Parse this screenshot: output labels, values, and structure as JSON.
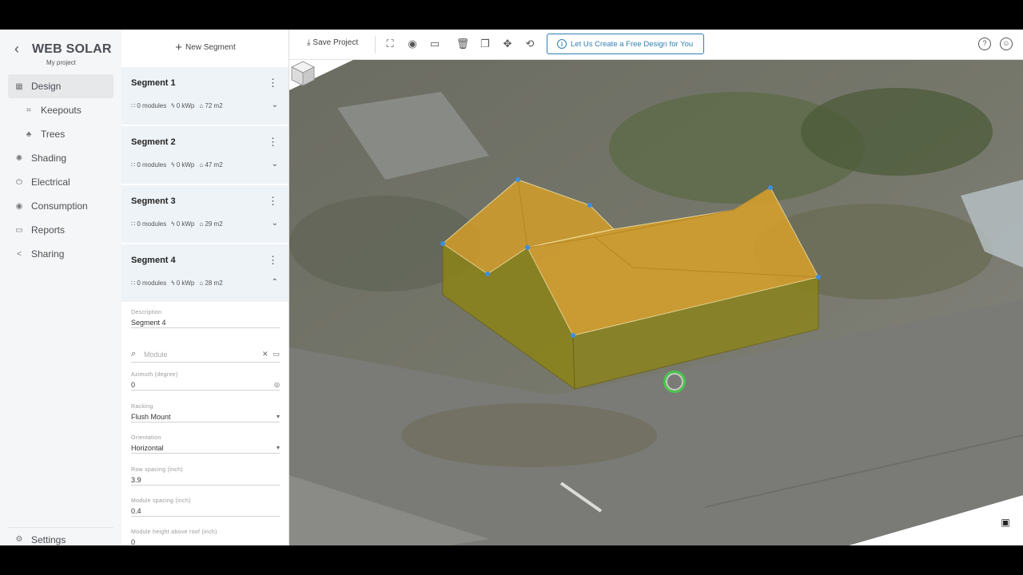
{
  "app": {
    "title": "WEB SOLAR",
    "subtitle": "My project"
  },
  "nav": {
    "items": [
      {
        "label": "Design",
        "icon": "grid-icon",
        "glyph": "▦"
      },
      {
        "label": "Keepouts",
        "icon": "keepout-icon",
        "glyph": "⌗"
      },
      {
        "label": "Trees",
        "icon": "tree-icon",
        "glyph": "♣"
      },
      {
        "label": "Shading",
        "icon": "sun-icon",
        "glyph": "✺"
      },
      {
        "label": "Electrical",
        "icon": "plug-icon",
        "glyph": "⏻"
      },
      {
        "label": "Consumption",
        "icon": "meter-icon",
        "glyph": "◉"
      },
      {
        "label": "Reports",
        "icon": "folder-icon",
        "glyph": "▭"
      },
      {
        "label": "Sharing",
        "icon": "share-icon",
        "glyph": "<"
      }
    ],
    "settings": {
      "label": "Settings",
      "icon": "gear-icon",
      "glyph": "⚙"
    }
  },
  "panel": {
    "new_segment": "New Segment",
    "segments": [
      {
        "name": "Segment 1",
        "modules": "0 modules",
        "kwp": "0 kWp",
        "area": "72 m2",
        "expanded": false
      },
      {
        "name": "Segment 2",
        "modules": "0 modules",
        "kwp": "0 kWp",
        "area": "47 m2",
        "expanded": false
      },
      {
        "name": "Segment 3",
        "modules": "0 modules",
        "kwp": "0 kWp",
        "area": "29 m2",
        "expanded": false
      },
      {
        "name": "Segment 4",
        "modules": "0 modules",
        "kwp": "0 kWp",
        "area": "28 m2",
        "expanded": true
      }
    ],
    "form": {
      "description_label": "Description",
      "description_value": "Segment 4",
      "module_placeholder": "Module",
      "azimuth_label": "Azimuth (degree)",
      "azimuth_value": "0",
      "racking_label": "Racking",
      "racking_value": "Flush Mount",
      "orientation_label": "Orientation",
      "orientation_value": "Horizontal",
      "row_spacing_label": "Row spacing (inch)",
      "row_spacing_value": "3.9",
      "module_spacing_label": "Module spacing (inch)",
      "module_spacing_value": "0.4",
      "module_height_label": "Module height above roof (inch)",
      "module_height_value": "0"
    }
  },
  "toolbar": {
    "save_label": "Save Project",
    "cta_label": "Let Us Create a Free Design for You",
    "icons": [
      "fullscreen-icon",
      "eye-icon",
      "ruler-icon",
      "trash-icon",
      "copy-icon",
      "move-icon",
      "history-icon",
      "help-icon",
      "account-icon"
    ]
  },
  "colors": {
    "roof_fill": "#d9a12a",
    "wall_fill": "#9a8a1a",
    "accent": "#2f7fb1",
    "cursor": "#4cc44c"
  }
}
